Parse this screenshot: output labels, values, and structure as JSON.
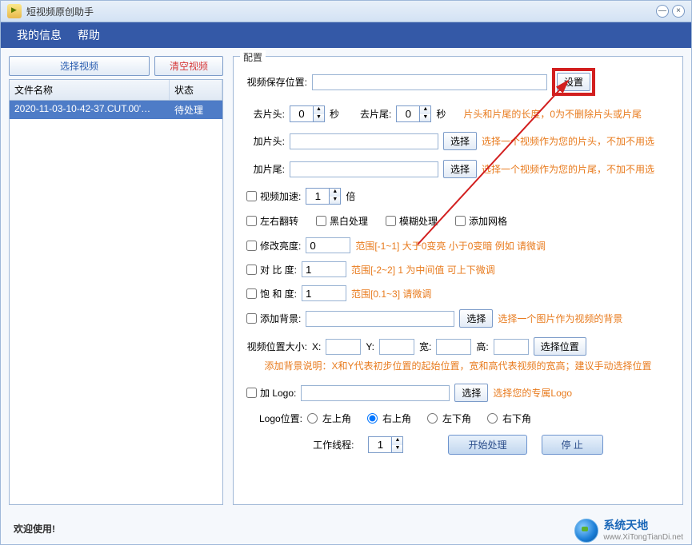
{
  "titlebar": {
    "title": "短视频原创助手"
  },
  "menu": {
    "myinfo": "我的信息",
    "help": "帮助"
  },
  "left": {
    "select_video": "选择视频",
    "clear_video": "清空视频",
    "col_name": "文件名称",
    "col_status": "状态",
    "row_name": "2020-11-03-10-42-37.CUT.00'…",
    "row_status": "待处理"
  },
  "panel_title": "配置",
  "save": {
    "label": "视频保存位置:",
    "value": "",
    "btn": "设置"
  },
  "trim": {
    "head_label": "去片头:",
    "head_val": "0",
    "sec1": "秒",
    "tail_label": "去片尾:",
    "tail_val": "0",
    "sec2": "秒",
    "hint": "片头和片尾的长度，0为不删除片头或片尾"
  },
  "addhead": {
    "label": "加片头:",
    "value": "",
    "btn": "选择",
    "hint": "选择一个视频作为您的片头，不加不用选"
  },
  "addtail": {
    "label": "加片尾:",
    "value": "",
    "btn": "选择",
    "hint": "选择一个视频作为您的片尾，不加不用选"
  },
  "speed": {
    "chk": "视频加速:",
    "val": "1",
    "unit": "倍"
  },
  "fx": {
    "flip": "左右翻转",
    "bw": "黑白处理",
    "blur": "模糊处理",
    "grid": "添加网格"
  },
  "bright": {
    "chk": "修改亮度:",
    "val": "0",
    "hint": "范围[-1~1]   大于0变亮 小于0变暗  例如 请微调"
  },
  "contrast": {
    "chk": "对 比  度:",
    "val": "1",
    "hint": "范围[-2~2]  1 为中间值  可上下微调"
  },
  "saturate": {
    "chk": "饱 和  度:",
    "val": "1",
    "hint": "范围[0.1~3]   请微调"
  },
  "bg": {
    "chk": "添加背景:",
    "val": "",
    "btn": "选择",
    "hint": "选择一个图片作为视频的背景"
  },
  "pos": {
    "label": "视频位置大小:",
    "x": "X:",
    "y": "Y:",
    "w": "宽:",
    "h": "高:",
    "btn": "选择位置",
    "note": "添加背景说明：X和Y代表初步位置的起始位置，宽和高代表视频的宽高；建议手动选择位置"
  },
  "logo": {
    "chk": "加 Logo:",
    "val": "",
    "btn": "选择",
    "hint": "选择您的专属Logo",
    "pos_label": "Logo位置:",
    "tl": "左上角",
    "tr": "右上角",
    "bl": "左下角",
    "br": "右下角"
  },
  "threads": {
    "label": "工作线程:",
    "val": "1"
  },
  "actions": {
    "start": "开始处理",
    "stop": "停   止"
  },
  "footer": {
    "welcome": "欢迎使用!",
    "brand": "系统天地",
    "url": "www.XiTongTianDi.net"
  }
}
